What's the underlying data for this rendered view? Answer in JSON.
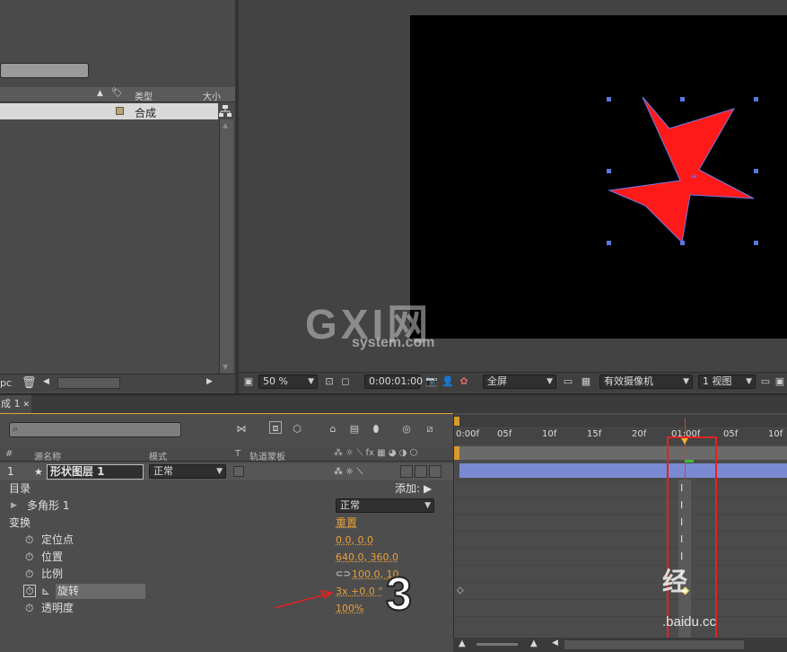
{
  "project": {
    "columns": {
      "type": "类型",
      "size": "大小"
    },
    "item_type": "合成",
    "footer_text": "pc"
  },
  "viewer": {
    "zoom": "50 %",
    "timecode": "0:00:01:00",
    "resolution": "全屏",
    "camera": "有效摄像机",
    "views": "1 视图"
  },
  "watermark": {
    "brand": "GXI网",
    "domain": "system.com"
  },
  "timeline": {
    "tab_label": "成 1",
    "columns": {
      "hash": "#",
      "source_name": "源名称",
      "mode": "模式",
      "t": "T",
      "track_matte": "轨道蒙板"
    },
    "ruler_ticks": [
      "0:00f",
      "05f",
      "10f",
      "15f",
      "20f",
      "01:00f",
      "05f",
      "10f"
    ],
    "layer": {
      "number": "1",
      "name": "形状图层 1",
      "mode": "正常"
    },
    "contents_label": "目录",
    "add_label": "添加:",
    "polygon_label": "多角形 1",
    "polygon_mode": "正常",
    "transform_label": "变换",
    "reset_label": "重置",
    "properties": [
      {
        "name": "定位点",
        "value": "0.0, 0.0"
      },
      {
        "name": "位置",
        "value": "640.0, 360.0"
      },
      {
        "name": "比例",
        "value": "100.0, 10"
      },
      {
        "name": "旋转",
        "value": "3x +0.0 °"
      },
      {
        "name": "透明度",
        "value": "100%"
      }
    ]
  },
  "annotation": {
    "step_number": "3"
  },
  "overlay_watermark": {
    "text": "经",
    "domain": ".baidu.cc"
  },
  "colors": {
    "star": "#ff1a1a",
    "accent": "#e8a03a",
    "highlight_box": "#e42222",
    "layer_bar": "#7a8ad2"
  }
}
